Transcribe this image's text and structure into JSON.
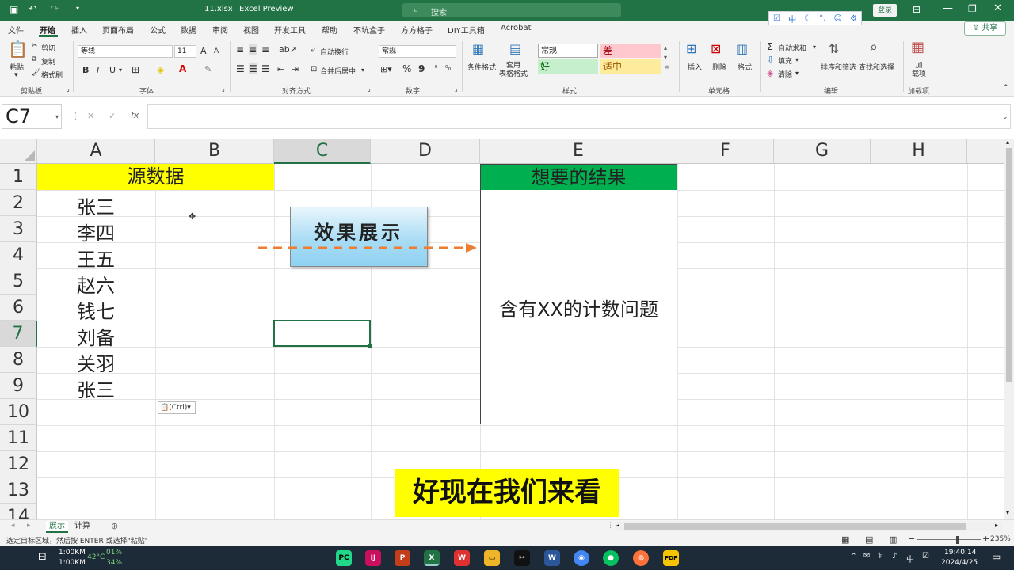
{
  "window": {
    "filename": "11.xlsx",
    "app": "Excel Preview",
    "search_placeholder": "搜索",
    "login": "登录"
  },
  "ime": {
    "mode": "中"
  },
  "menu": {
    "items": [
      "文件",
      "开始",
      "插入",
      "页面布局",
      "公式",
      "数据",
      "审阅",
      "视图",
      "开发工具",
      "帮助",
      "不坑盒子",
      "方方格子",
      "DIY工具箱",
      "Acrobat"
    ],
    "active": "开始",
    "share": "共享"
  },
  "ribbon": {
    "clipboard": {
      "paste": "粘贴",
      "cut": "剪切",
      "copy": "复制",
      "format_painter": "格式刷",
      "group": "剪贴板"
    },
    "font": {
      "name": "等线",
      "size": "11",
      "bold": "B",
      "italic": "I",
      "underline": "U",
      "grow": "A",
      "shrink": "A",
      "group": "字体"
    },
    "alignment": {
      "wrap": "自动换行",
      "merge": "合并后居中",
      "group": "对齐方式"
    },
    "number": {
      "format": "常规",
      "percent": "%",
      "comma": "9",
      "group": "数字"
    },
    "styles": {
      "cond_format": "条件格式",
      "table_format": "套用\n表格格式",
      "normal": "常规",
      "bad": "差",
      "good": "好",
      "neutral": "适中",
      "group": "样式"
    },
    "cells": {
      "insert": "插入",
      "delete": "删除",
      "format": "格式",
      "group": "单元格"
    },
    "editing": {
      "autosum": "自动求和",
      "fill": "填充",
      "clear": "清除",
      "sort_filter": "排序和筛选",
      "find_select": "查找和选择",
      "group": "编辑"
    },
    "addins": {
      "addins": "加\n载项",
      "group": "加载项"
    }
  },
  "formula_bar": {
    "name_box": "C7",
    "formula": ""
  },
  "grid": {
    "columns": [
      "A",
      "B",
      "C",
      "D",
      "E",
      "F",
      "G",
      "H"
    ],
    "selected_column": "C",
    "rows": [
      "1",
      "2",
      "3",
      "4",
      "5",
      "6",
      "7",
      "8",
      "9",
      "10",
      "11",
      "12",
      "13",
      "14"
    ],
    "selected_row": "7",
    "header_source": "源数据",
    "header_result": "想要的结果",
    "names": [
      "张三",
      "李四",
      "王五",
      "赵六",
      "钱七",
      "刘备",
      "关羽",
      "张三"
    ],
    "result_text": "含有XX的计数问题",
    "demo_button": "效果展示",
    "paste_options": "(Ctrl)"
  },
  "subtitle": "好现在我们来看",
  "sheets": {
    "tabs": [
      "展示",
      "计算"
    ],
    "active": "展示"
  },
  "status": {
    "message": "选定目标区域，然后按 ENTER 或选择\"粘贴\"",
    "zoom": "235%"
  },
  "taskbar": {
    "net_up": "1:00KM",
    "net_down": "1:00KM",
    "temp": "42°C",
    "cpu": "01%",
    "mem": "34%",
    "time": "19:40:14",
    "date": "2024/4/25",
    "ime": "中"
  },
  "colors": {
    "excel_green": "#217346",
    "source_header_bg": "#ffff00",
    "result_header_bg": "#00b050",
    "arrow": "#ed7d31"
  }
}
